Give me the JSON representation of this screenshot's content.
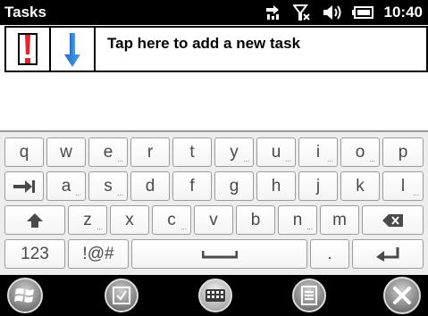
{
  "status_bar": {
    "app_title": "Tasks",
    "time": "10:40",
    "icons": [
      "data-connection-icon",
      "signal-no-service-icon",
      "volume-icon",
      "battery-icon"
    ]
  },
  "task_entry": {
    "placeholder": "Tap here to add a new task",
    "priority_high_icon": "exclamation-icon",
    "priority_low_icon": "down-arrow-icon",
    "priority_high_color": "#e8232a",
    "priority_low_color": "#2a7fd4"
  },
  "keyboard": {
    "row1": [
      {
        "ch": "q",
        "sub": ""
      },
      {
        "ch": "w",
        "sub": ""
      },
      {
        "ch": "e",
        "sub": "..."
      },
      {
        "ch": "r",
        "sub": ""
      },
      {
        "ch": "t",
        "sub": ""
      },
      {
        "ch": "y",
        "sub": "..."
      },
      {
        "ch": "u",
        "sub": "..."
      },
      {
        "ch": "i",
        "sub": "..."
      },
      {
        "ch": "o",
        "sub": "..."
      },
      {
        "ch": "p",
        "sub": ""
      }
    ],
    "row2": [
      {
        "ch": "a",
        "sub": "..."
      },
      {
        "ch": "s",
        "sub": "..."
      },
      {
        "ch": "d",
        "sub": ""
      },
      {
        "ch": "f",
        "sub": ""
      },
      {
        "ch": "g",
        "sub": ""
      },
      {
        "ch": "h",
        "sub": ""
      },
      {
        "ch": "j",
        "sub": ""
      },
      {
        "ch": "k",
        "sub": ""
      },
      {
        "ch": "l",
        "sub": "..."
      }
    ],
    "row3": [
      {
        "ch": "z",
        "sub": "..."
      },
      {
        "ch": "x",
        "sub": ""
      },
      {
        "ch": "c",
        "sub": "..."
      },
      {
        "ch": "v",
        "sub": ""
      },
      {
        "ch": "b",
        "sub": ""
      },
      {
        "ch": "n",
        "sub": "..."
      },
      {
        "ch": "m",
        "sub": ""
      }
    ],
    "numbers_key": "123",
    "symbols_key": "!@#",
    "period_key": ".",
    "tab_icon": "tab-icon",
    "shift_icon": "shift-icon",
    "backspace_icon": "backspace-icon",
    "space_icon": "space-icon",
    "enter_icon": "enter-icon"
  },
  "menu_bar": {
    "buttons": [
      "windows-start-icon",
      "checkbox-icon",
      "keyboard-icon",
      "menu-list-icon",
      "close-icon"
    ]
  }
}
